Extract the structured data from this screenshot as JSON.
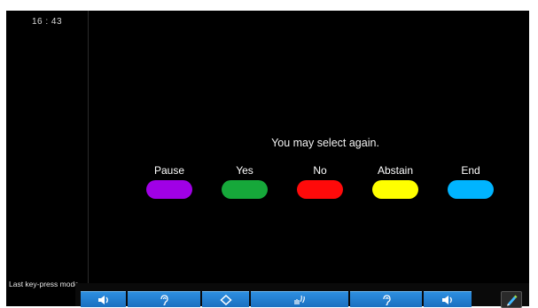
{
  "status": {
    "time": "16 : 43",
    "mode": "Last key-press mode"
  },
  "prompt": "You may select again.",
  "options": [
    {
      "label": "Pause",
      "color": "#a000e6"
    },
    {
      "label": "Yes",
      "color": "#16a83a"
    },
    {
      "label": "No",
      "color": "#ff0a0a"
    },
    {
      "label": "Abstain",
      "color": "#ffff00"
    },
    {
      "label": "End",
      "color": "#00b4ff"
    }
  ],
  "taskbar": {
    "buttons": [
      {
        "icon": "speaker-icon"
      },
      {
        "icon": "ear-icon"
      },
      {
        "icon": "diamond-icon"
      },
      {
        "icon": "hand-wave-icon"
      },
      {
        "icon": "ear-icon"
      },
      {
        "icon": "speaker-icon"
      }
    ],
    "pen_icon": "pen-icon",
    "accent": "#1f7fd4"
  }
}
